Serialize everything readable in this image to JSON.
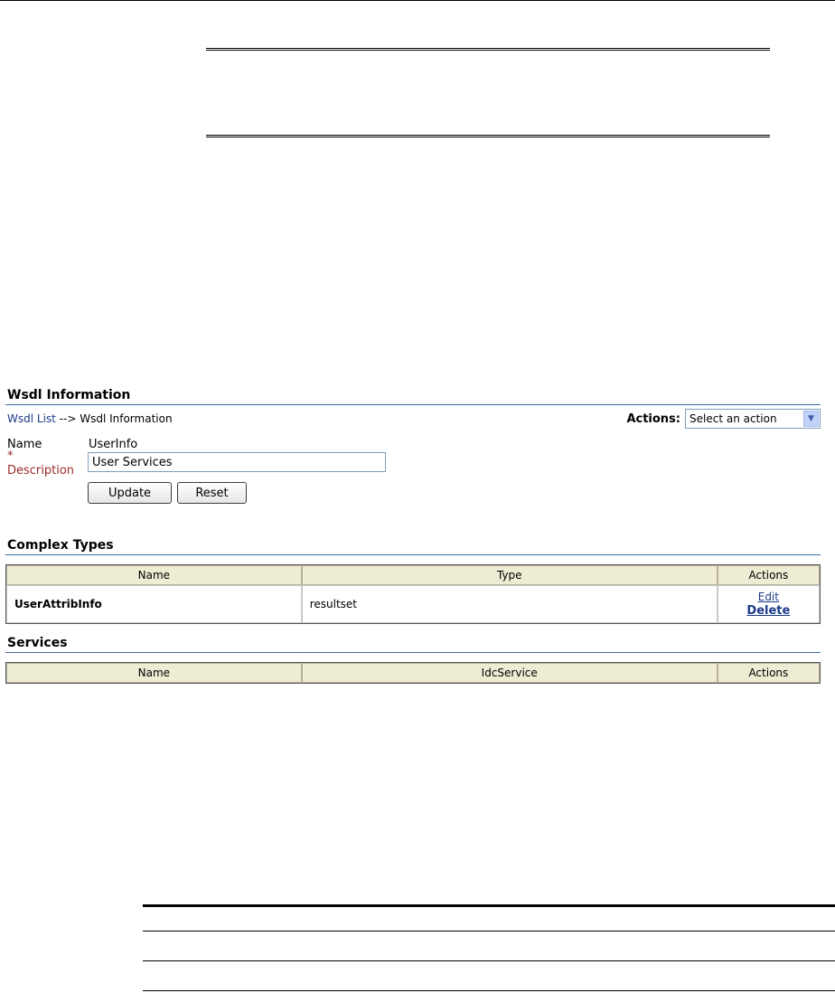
{
  "wsdl_info": {
    "title": "Wsdl Information",
    "breadcrumb": {
      "link": "Wsdl List",
      "separator": " --> ",
      "current": "Wsdl Information"
    },
    "actions": {
      "label": "Actions:",
      "select_value": "Select an action"
    },
    "form": {
      "name_label": "Name",
      "name_value": "UserInfo",
      "required_marker": "*",
      "description_label": "Description",
      "description_value": "User Services",
      "update_button": "Update",
      "reset_button": "Reset"
    }
  },
  "complex_types": {
    "title": "Complex Types",
    "columns": [
      "Name",
      "Type",
      "Actions"
    ],
    "rows": [
      {
        "name": "UserAttribInfo",
        "type": "resultset",
        "edit": "Edit",
        "delete": "Delete"
      }
    ]
  },
  "services": {
    "title": "Services",
    "columns": [
      "Name",
      "IdcService",
      "Actions"
    ]
  }
}
